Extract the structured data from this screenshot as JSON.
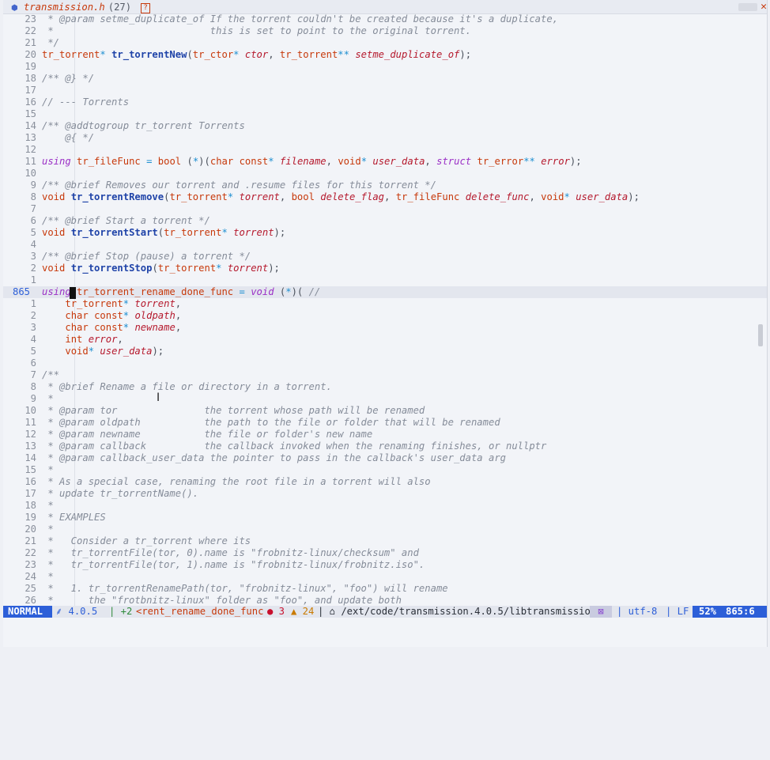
{
  "tab": {
    "filename": "transmission.h",
    "count": "(27)",
    "help_glyph": "?",
    "close_glyph": "✕"
  },
  "lines": [
    {
      "n": "23",
      "t": [
        [
          "cm",
          " * @param setme_duplicate_of If the torrent couldn't be created because it's a duplicate,"
        ]
      ]
    },
    {
      "n": "22",
      "t": [
        [
          "cm",
          " *                           this is set to point to the original torrent."
        ]
      ]
    },
    {
      "n": "21",
      "t": [
        [
          "cm",
          " */"
        ]
      ]
    },
    {
      "n": "20",
      "t": [
        [
          "ty",
          "tr_torrent"
        ],
        [
          "op",
          "*"
        ],
        [
          "pu",
          " "
        ],
        [
          "fn",
          "tr_torrentNew"
        ],
        [
          "pu",
          "("
        ],
        [
          "ty",
          "tr_ctor"
        ],
        [
          "op",
          "*"
        ],
        [
          "pu",
          " "
        ],
        [
          "pa",
          "ctor"
        ],
        [
          "pu",
          ", "
        ],
        [
          "ty",
          "tr_torrent"
        ],
        [
          "op",
          "**"
        ],
        [
          "pu",
          " "
        ],
        [
          "pa",
          "setme_duplicate_of"
        ],
        [
          "pu",
          ");"
        ]
      ]
    },
    {
      "n": "19",
      "t": []
    },
    {
      "n": "18",
      "t": [
        [
          "cm",
          "/** @} */"
        ]
      ]
    },
    {
      "n": "17",
      "t": []
    },
    {
      "n": "16",
      "t": [
        [
          "cm",
          "// --- Torrents"
        ]
      ]
    },
    {
      "n": "15",
      "t": []
    },
    {
      "n": "14",
      "t": [
        [
          "cm",
          "/** @addtogroup tr_torrent Torrents"
        ]
      ]
    },
    {
      "n": "13",
      "t": [
        [
          "cm",
          "    @{ */"
        ]
      ]
    },
    {
      "n": "12",
      "t": []
    },
    {
      "n": "11",
      "t": [
        [
          "kw",
          "using"
        ],
        [
          "pu",
          " "
        ],
        [
          "ty",
          "tr_fileFunc"
        ],
        [
          "pu",
          " "
        ],
        [
          "op",
          "="
        ],
        [
          "pu",
          " "
        ],
        [
          "ty",
          "bool"
        ],
        [
          "pu",
          " ("
        ],
        [
          "op",
          "*"
        ],
        [
          "pu",
          ")("
        ],
        [
          "ty",
          "char"
        ],
        [
          "pu",
          " "
        ],
        [
          "ty",
          "const"
        ],
        [
          "op",
          "*"
        ],
        [
          "pu",
          " "
        ],
        [
          "pa",
          "filename"
        ],
        [
          "pu",
          ", "
        ],
        [
          "ty",
          "void"
        ],
        [
          "op",
          "*"
        ],
        [
          "pu",
          " "
        ],
        [
          "pa",
          "user_data"
        ],
        [
          "pu",
          ", "
        ],
        [
          "kw",
          "struct"
        ],
        [
          "pu",
          " "
        ],
        [
          "ty",
          "tr_error"
        ],
        [
          "op",
          "**"
        ],
        [
          "pu",
          " "
        ],
        [
          "pa",
          "error"
        ],
        [
          "pu",
          ");"
        ]
      ]
    },
    {
      "n": "10",
      "t": []
    },
    {
      "n": "9",
      "t": [
        [
          "cm",
          "/** @brief Removes our torrent and .resume files for this torrent */"
        ]
      ]
    },
    {
      "n": "8",
      "t": [
        [
          "ty",
          "void"
        ],
        [
          "pu",
          " "
        ],
        [
          "fn",
          "tr_torrentRemove"
        ],
        [
          "pu",
          "("
        ],
        [
          "ty",
          "tr_torrent"
        ],
        [
          "op",
          "*"
        ],
        [
          "pu",
          " "
        ],
        [
          "pa",
          "torrent"
        ],
        [
          "pu",
          ", "
        ],
        [
          "ty",
          "bool"
        ],
        [
          "pu",
          " "
        ],
        [
          "pa",
          "delete_flag"
        ],
        [
          "pu",
          ", "
        ],
        [
          "ty",
          "tr_fileFunc"
        ],
        [
          "pu",
          " "
        ],
        [
          "pa",
          "delete_func"
        ],
        [
          "pu",
          ", "
        ],
        [
          "ty",
          "void"
        ],
        [
          "op",
          "*"
        ],
        [
          "pu",
          " "
        ],
        [
          "pa",
          "user_data"
        ],
        [
          "pu",
          ");"
        ]
      ]
    },
    {
      "n": "7",
      "t": []
    },
    {
      "n": "6",
      "t": [
        [
          "cm",
          "/** @brief Start a torrent */"
        ]
      ]
    },
    {
      "n": "5",
      "t": [
        [
          "ty",
          "void"
        ],
        [
          "pu",
          " "
        ],
        [
          "fn",
          "tr_torrentStart"
        ],
        [
          "pu",
          "("
        ],
        [
          "ty",
          "tr_torrent"
        ],
        [
          "op",
          "*"
        ],
        [
          "pu",
          " "
        ],
        [
          "pa",
          "torrent"
        ],
        [
          "pu",
          ");"
        ]
      ]
    },
    {
      "n": "4",
      "t": []
    },
    {
      "n": "3",
      "t": [
        [
          "cm",
          "/** @brief Stop (pause) a torrent */"
        ]
      ]
    },
    {
      "n": "2",
      "t": [
        [
          "ty",
          "void"
        ],
        [
          "pu",
          " "
        ],
        [
          "fn",
          "tr_torrentStop"
        ],
        [
          "pu",
          "("
        ],
        [
          "ty",
          "tr_torrent"
        ],
        [
          "op",
          "*"
        ],
        [
          "pu",
          " "
        ],
        [
          "pa",
          "torrent"
        ],
        [
          "pu",
          ");"
        ]
      ]
    },
    {
      "n": "1",
      "t": []
    },
    {
      "n": "865",
      "current": true,
      "t": [
        [
          "kw",
          "using"
        ],
        [
          "pu",
          " "
        ],
        [
          "ty",
          "tr_torrent_rename_done_func"
        ],
        [
          "pu",
          " "
        ],
        [
          "op",
          "="
        ],
        [
          "pu",
          " "
        ],
        [
          "kw",
          "void"
        ],
        [
          "pu",
          " ("
        ],
        [
          "op",
          "*"
        ],
        [
          "pu",
          ")( "
        ],
        [
          "cm",
          "//"
        ]
      ]
    },
    {
      "n": "1",
      "t": [
        [
          "pu",
          "    "
        ],
        [
          "ty",
          "tr_torrent"
        ],
        [
          "op",
          "*"
        ],
        [
          "pu",
          " "
        ],
        [
          "pa",
          "torrent"
        ],
        [
          "pu",
          ","
        ]
      ]
    },
    {
      "n": "2",
      "t": [
        [
          "pu",
          "    "
        ],
        [
          "ty",
          "char"
        ],
        [
          "pu",
          " "
        ],
        [
          "ty",
          "const"
        ],
        [
          "op",
          "*"
        ],
        [
          "pu",
          " "
        ],
        [
          "pa",
          "oldpath"
        ],
        [
          "pu",
          ","
        ]
      ]
    },
    {
      "n": "3",
      "t": [
        [
          "pu",
          "    "
        ],
        [
          "ty",
          "char"
        ],
        [
          "pu",
          " "
        ],
        [
          "ty",
          "const"
        ],
        [
          "op",
          "*"
        ],
        [
          "pu",
          " "
        ],
        [
          "pa",
          "newname"
        ],
        [
          "pu",
          ","
        ]
      ]
    },
    {
      "n": "4",
      "t": [
        [
          "pu",
          "    "
        ],
        [
          "ty",
          "int"
        ],
        [
          "pu",
          " "
        ],
        [
          "pa",
          "error"
        ],
        [
          "pu",
          ","
        ]
      ]
    },
    {
      "n": "5",
      "t": [
        [
          "pu",
          "    "
        ],
        [
          "ty",
          "void"
        ],
        [
          "op",
          "*"
        ],
        [
          "pu",
          " "
        ],
        [
          "pa",
          "user_data"
        ],
        [
          "pu",
          ");"
        ]
      ]
    },
    {
      "n": "6",
      "t": []
    },
    {
      "n": "7",
      "t": [
        [
          "cm",
          "/**"
        ]
      ]
    },
    {
      "n": "8",
      "t": [
        [
          "cm",
          " * @brief Rename a file or directory in a torrent."
        ]
      ]
    },
    {
      "n": "9",
      "t": [
        [
          "cm",
          " *"
        ]
      ]
    },
    {
      "n": "10",
      "t": [
        [
          "cm",
          " * @param tor               the torrent whose path will be renamed"
        ]
      ]
    },
    {
      "n": "11",
      "t": [
        [
          "cm",
          " * @param oldpath           the path to the file or folder that will be renamed"
        ]
      ]
    },
    {
      "n": "12",
      "t": [
        [
          "cm",
          " * @param newname           the file or folder's new name"
        ]
      ]
    },
    {
      "n": "13",
      "t": [
        [
          "cm",
          " * @param callback          the callback invoked when the renaming finishes, or nullptr"
        ]
      ]
    },
    {
      "n": "14",
      "t": [
        [
          "cm",
          " * @param callback_user_data the pointer to pass in the callback's user_data arg"
        ]
      ]
    },
    {
      "n": "15",
      "t": [
        [
          "cm",
          " *"
        ]
      ]
    },
    {
      "n": "16",
      "t": [
        [
          "cm",
          " * As a special case, renaming the root file in a torrent will also"
        ]
      ]
    },
    {
      "n": "17",
      "t": [
        [
          "cm",
          " * update tr_torrentName()."
        ]
      ]
    },
    {
      "n": "18",
      "t": [
        [
          "cm",
          " *"
        ]
      ]
    },
    {
      "n": "19",
      "t": [
        [
          "cm",
          " * EXAMPLES"
        ]
      ]
    },
    {
      "n": "20",
      "t": [
        [
          "cm",
          " *"
        ]
      ]
    },
    {
      "n": "21",
      "t": [
        [
          "cm",
          " *   Consider a tr_torrent where its"
        ]
      ]
    },
    {
      "n": "22",
      "t": [
        [
          "cm",
          " *   tr_torrentFile(tor, 0).name is \"frobnitz-linux/checksum\" and"
        ]
      ]
    },
    {
      "n": "23",
      "t": [
        [
          "cm",
          " *   tr_torrentFile(tor, 1).name is \"frobnitz-linux/frobnitz.iso\"."
        ]
      ]
    },
    {
      "n": "24",
      "t": [
        [
          "cm",
          " *"
        ]
      ]
    },
    {
      "n": "25",
      "t": [
        [
          "cm",
          " *   1. tr_torrentRenamePath(tor, \"frobnitz-linux\", \"foo\") will rename"
        ]
      ]
    },
    {
      "n": "26",
      "t": [
        [
          "cm",
          " *      the \"frotbnitz-linux\" folder as \"foo\", and update both"
        ]
      ]
    }
  ],
  "statusline": {
    "mode": "NORMAL",
    "branch": "⸙ 4.0.5",
    "added": "| +2",
    "function": "<rent_rename_done_func",
    "errors": "● 3",
    "warnings": "▲ 24",
    "path": "| ⌂ /ext/code/transmission.4.0.5/libtransmission",
    "nav_glyph": "⊠",
    "encoding": "| utf-8",
    "eol": "| LF",
    "percent": "52%",
    "position": "865:6"
  },
  "ibeam_glyph": "I"
}
